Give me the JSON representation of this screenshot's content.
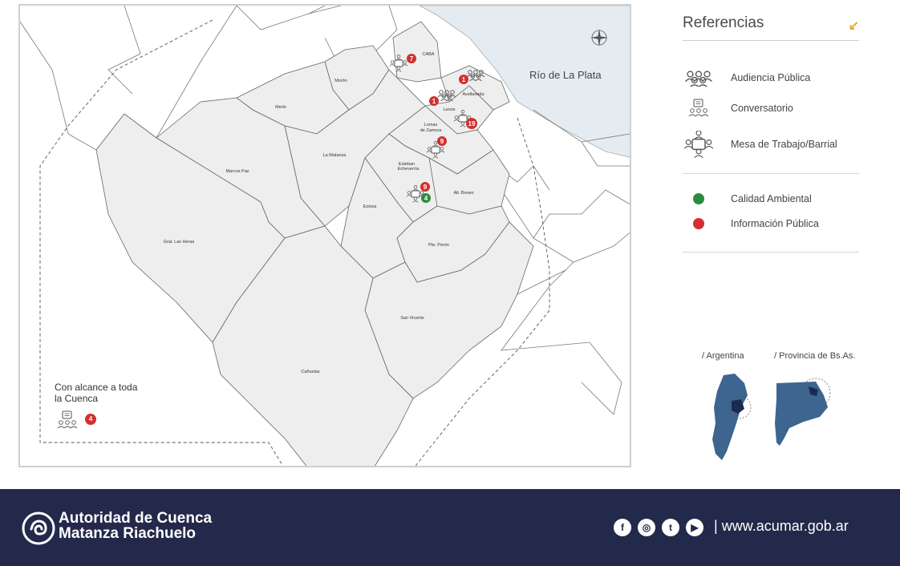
{
  "map": {
    "river_label": "Río de La Plata",
    "municipalities": {
      "caba": "CABA",
      "moron": "Morón",
      "merlo": "Merlo",
      "avellaneda": "Avellaneda",
      "lanus": "Lanús",
      "lomas_1": "Lomas",
      "lomas_2": "de Zamora",
      "la_matanza": "La Matanza",
      "marcos_paz": "Marcos Paz",
      "echeverria_1": "Esteban",
      "echeverria_2": "Echeverría",
      "ezeiza": "Ezeiza",
      "alte_brown": "Alt. Brown",
      "gral_las_heras": "Gral. Las Heras",
      "pte_peron": "Pte. Perón",
      "san_vicente": "San Vicente",
      "canuelas": "Cañuelas"
    },
    "markers": [
      {
        "location": "CABA",
        "type": "Mesa de Trabajo/Barrial",
        "count": "7",
        "category": "Información Pública"
      },
      {
        "location": "Avellaneda",
        "type": "Audiencia Pública",
        "count": "1",
        "category": "Información Pública"
      },
      {
        "location": "Lanús",
        "type": "Audiencia Pública",
        "count": "1",
        "category": "Información Pública"
      },
      {
        "location": "Lomas de Zamora",
        "type": "Mesa de Trabajo/Barrial",
        "count": "19",
        "category": "Información Pública"
      },
      {
        "location": "Lomas de Zamora",
        "type": "Mesa de Trabajo/Barrial",
        "count": "9",
        "category": "Información Pública"
      },
      {
        "location": "Esteban Echeverría",
        "type": "Mesa de Trabajo/Barrial",
        "count": "9",
        "category": "Información Pública"
      },
      {
        "location": "Esteban Echeverría",
        "type": "Mesa de Trabajo/Barrial",
        "count": "4",
        "category": "Calidad Ambiental"
      }
    ],
    "whole_basin": {
      "label": "Con alcance a toda la Cuenca",
      "type": "Conversatorio",
      "count": "4",
      "category": "Información Pública"
    }
  },
  "legend": {
    "title": "Referencias",
    "types": [
      {
        "icon": "audiencia-publica-icon",
        "label": "Audiencia Pública"
      },
      {
        "icon": "conversatorio-icon",
        "label": "Conversatorio"
      },
      {
        "icon": "mesa-trabajo-icon",
        "label": "Mesa de Trabajo/Barrial"
      }
    ],
    "categories": [
      {
        "label": "Calidad Ambiental",
        "color": "#2e8b3e"
      },
      {
        "label": "Información Pública",
        "color": "#d32f2f"
      }
    ]
  },
  "minimaps": {
    "argentina": "/ Argentina",
    "provincia": "/ Provincia de Bs.As."
  },
  "colors": {
    "footer_bg": "#23294a",
    "river": "#e4ecf2",
    "land": "#eeeeee",
    "minimap": "#3d6590",
    "minimap_highlight": "#1b2a55",
    "accent": "#e8a33a"
  },
  "footer": {
    "brand_line1": "Autoridad de Cuenca",
    "brand_line2": "Matanza Riachuelo",
    "social": [
      "facebook-icon",
      "instagram-icon",
      "twitter-icon",
      "youtube-icon"
    ],
    "separator": "|",
    "website": "www.acumar.gob.ar"
  }
}
